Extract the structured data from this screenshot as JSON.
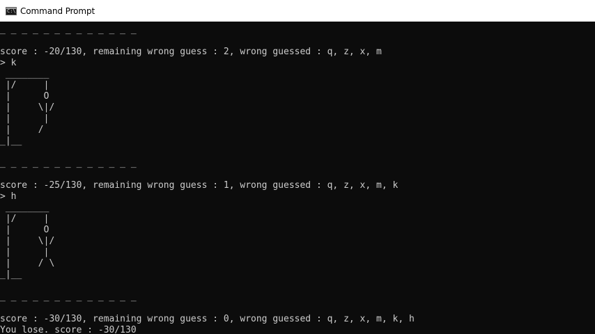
{
  "window": {
    "title": "Command Prompt",
    "icon": "console-icon",
    "icon_glyph": "C:\\"
  },
  "console": {
    "text_color": "#cccccc",
    "background": "#0c0c0c",
    "lines": [
      "_ _ _ _ _ _ _ _ _ _ _ _ _",
      "",
      "score : -20/130, remaining wrong guess : 2, wrong guessed : q, z, x, m",
      "> k",
      " ________",
      " |/     |",
      " |      O",
      " |     \\|/",
      " |      |",
      " |     /",
      "_|__",
      "",
      "_ _ _ _ _ _ _ _ _ _ _ _ _",
      "",
      "score : -25/130, remaining wrong guess : 1, wrong guessed : q, z, x, m, k",
      "> h",
      " ________",
      " |/     |",
      " |      O",
      " |     \\|/",
      " |      |",
      " |     / \\",
      "_|__",
      "",
      "_ _ _ _ _ _ _ _ _ _ _ _ _",
      "",
      "score : -30/130, remaining wrong guess : 0, wrong guessed : q, z, x, m, k, h",
      "You lose. score : -30/130"
    ]
  }
}
